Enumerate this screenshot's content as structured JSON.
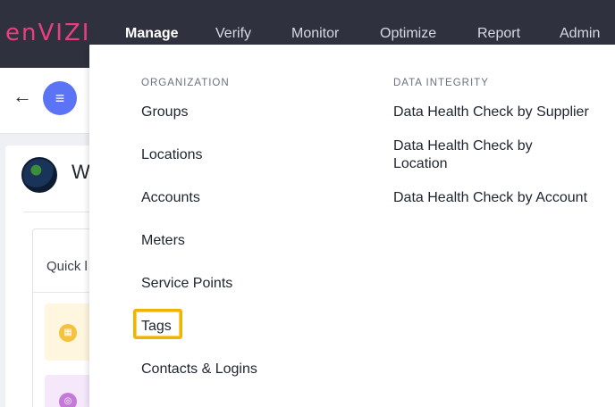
{
  "app": {
    "logo_text": "enVIZI"
  },
  "topnav": {
    "items": [
      {
        "label": "Manage",
        "active": true
      },
      {
        "label": "Verify"
      },
      {
        "label": "Monitor"
      },
      {
        "label": "Optimize"
      },
      {
        "label": "Report"
      },
      {
        "label": "Admin"
      }
    ]
  },
  "subbar": {
    "back_icon": "arrow-left-icon",
    "menu_icon": "hamburger-menu-icon"
  },
  "background": {
    "welcome_text": "W",
    "quick_label": "Quick l",
    "tile1_icon": "calendar-icon",
    "tile2_icon": "location-pin-icon"
  },
  "dropdown": {
    "organization": {
      "header": "ORGANIZATION",
      "items": [
        "Groups",
        "Locations",
        "Accounts",
        "Meters",
        "Service Points",
        "Tags",
        "Contacts & Logins"
      ]
    },
    "data_integrity": {
      "header": "DATA INTEGRITY",
      "items": [
        "Data Health Check by Supplier",
        "Data Health Check by Location",
        "Data Health Check by Account"
      ]
    },
    "highlighted_item": "Tags",
    "highlight_color": "#f0b400"
  },
  "colors": {
    "topbar": "#2f323e",
    "logo": "#e8407f",
    "menu_button": "#5a74f5"
  }
}
